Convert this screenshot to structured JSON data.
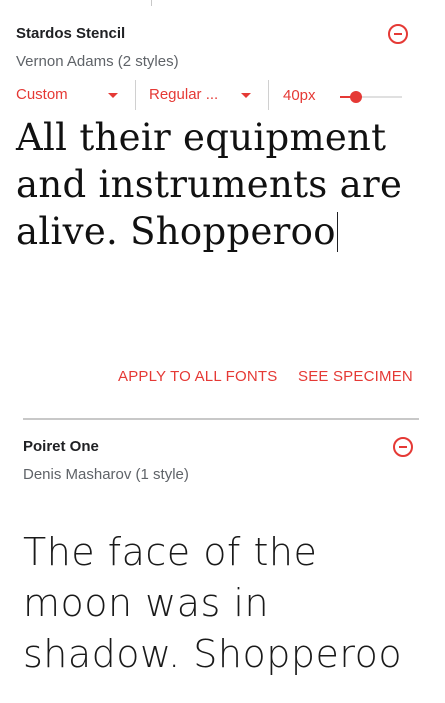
{
  "cards": [
    {
      "family": "Stardos Stencil",
      "designer": "Vernon Adams (2 styles)",
      "controls": {
        "sample_type": "Custom",
        "style": "Regular ...",
        "size": "40px",
        "size_slider_fraction": 0.25
      },
      "sample_text": "All their equipment and instruments are alive. Shopperoo",
      "actions": {
        "apply_all": "APPLY TO ALL FONTS",
        "see_specimen": "SEE SPECIMEN"
      }
    },
    {
      "family": "Poiret One",
      "designer": "Denis Masharov (1 style)",
      "sample_text": "The face of the moon was in shadow. Shopperoo"
    }
  ],
  "icons": {
    "remove": "remove-circle-icon",
    "dropdown": "arrow-drop-down-icon"
  },
  "colors": {
    "accent": "#e53935",
    "secondary_text": "#5f6368",
    "divider": "#c8c8c8"
  }
}
